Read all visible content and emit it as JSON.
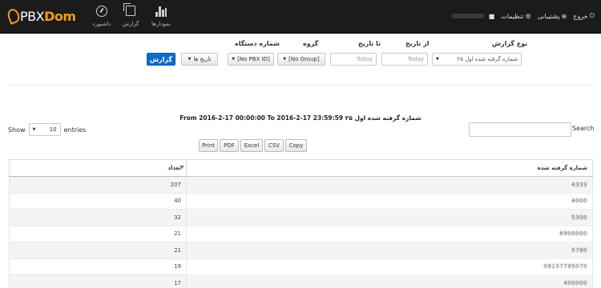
{
  "navbar": {
    "logo_prefix": "PBX",
    "logo_brand": "Dom",
    "charts_label": "نمودارها",
    "report_label": "گزارش",
    "dashboard_label": "داشبورد",
    "logout_label": "خروج",
    "support_label": "پشتیبانی",
    "settings_label": "تنظیمات"
  },
  "form": {
    "report_type_label": "نوع گزارش",
    "report_type_value": "۲۵ شماره گرفته شده اول",
    "from_date_label": "از تاریخ",
    "from_date_placeholder": "Today",
    "to_date_label": "تا تاریخ",
    "to_date_placeholder": "Today",
    "group_label": "گروه",
    "group_value": "[No Group]",
    "device_label": "شماره دستگاه",
    "device_value": "[No PBX ID]",
    "history_label": "تاریخ ها",
    "submit_label": "گزارش"
  },
  "report": {
    "title": "From 2016-2-17 00:00:00 To 2016-2-17 23:59:59 ۲۵ شماره گرفته شده اول",
    "show_label": "Show",
    "entries_value": "10",
    "entries_label": "entries",
    "search_label": "Search"
  },
  "export_buttons": [
    "Print",
    "PDF",
    "Excel",
    "CSV",
    "Copy"
  ],
  "table": {
    "col_number": "شماره گرفته شده",
    "col_count": "تعداد",
    "rows": [
      {
        "number": "4333",
        "count": "207"
      },
      {
        "number": "4000",
        "count": "40"
      },
      {
        "number": "5300",
        "count": "32"
      },
      {
        "number": "6900000",
        "count": "21"
      },
      {
        "number": "5780",
        "count": "21"
      },
      {
        "number": "09157795070",
        "count": "19"
      },
      {
        "number": "400000",
        "count": "17"
      }
    ]
  },
  "colors": {
    "navbar_bg": "#1b1b1b",
    "brand_accent": "#f39c12",
    "primary_button": "#0e6ec8"
  }
}
